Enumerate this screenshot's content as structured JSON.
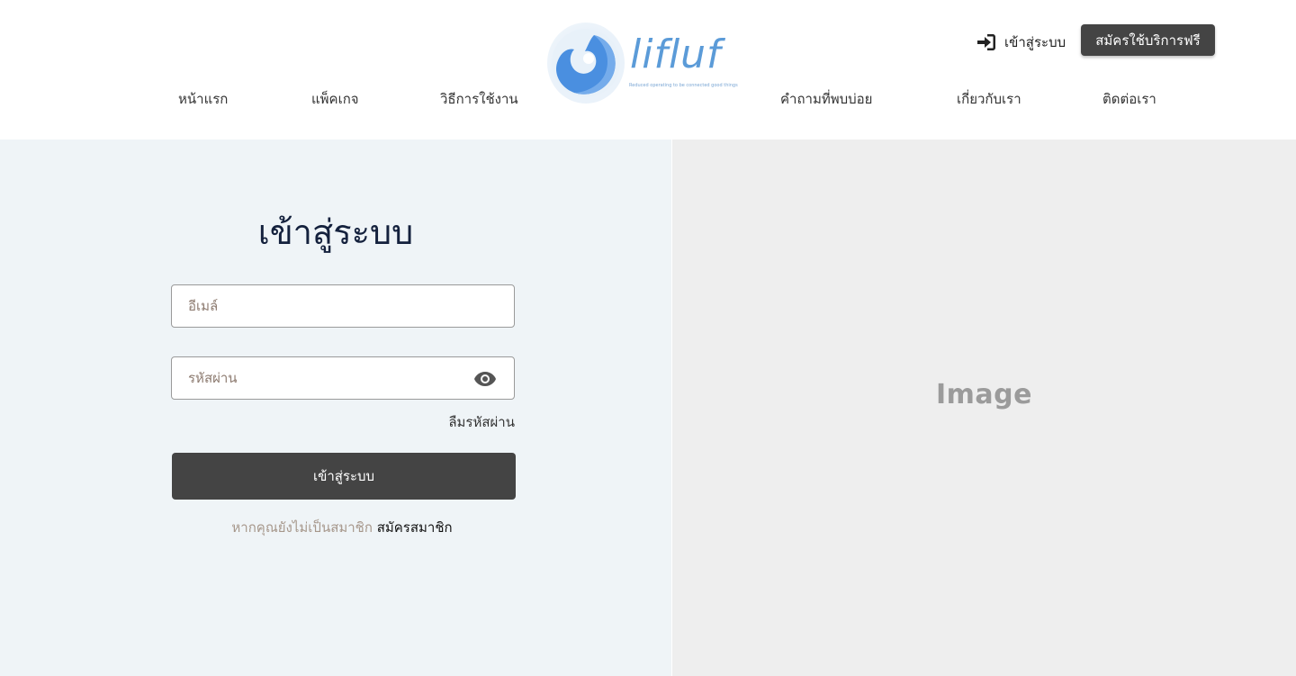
{
  "brand": {
    "name": "lifluf",
    "tagline": "Reduced operating to be connected good things"
  },
  "nav": {
    "items": [
      {
        "label": "หน้าแรก"
      },
      {
        "label": "แพ็คเกจ"
      },
      {
        "label": "วิธีการใช้งาน"
      },
      {
        "label": "คำถามที่พบบ่อย"
      },
      {
        "label": "เกี่ยวกับเรา"
      },
      {
        "label": "ติดต่อเรา"
      }
    ],
    "login_label": "เข้าสู่ระบบ",
    "login_icon": "sign-in-icon",
    "signup_label": "สมัครใช้บริการฟรี"
  },
  "form": {
    "title": "เข้าสู่ระบบ",
    "email_placeholder": "อีเมล์",
    "password_placeholder": "รหัสผ่าน",
    "password_toggle_icon": "eye-icon",
    "forgot_label": "ลืมรหัสผ่าน",
    "submit_label": "เข้าสู่ระบบ",
    "register_prompt": "หากคุณยังไม่เป็นสมาชิก",
    "register_link": "สมัครสมาชิก"
  },
  "image_placeholder": {
    "label": "Image"
  },
  "colors": {
    "dark_button": "#444444",
    "left_bg": "#eff4f7",
    "right_bg": "#eeeeee",
    "title": "#14213d",
    "brand_blue": "#5b9bd8"
  }
}
